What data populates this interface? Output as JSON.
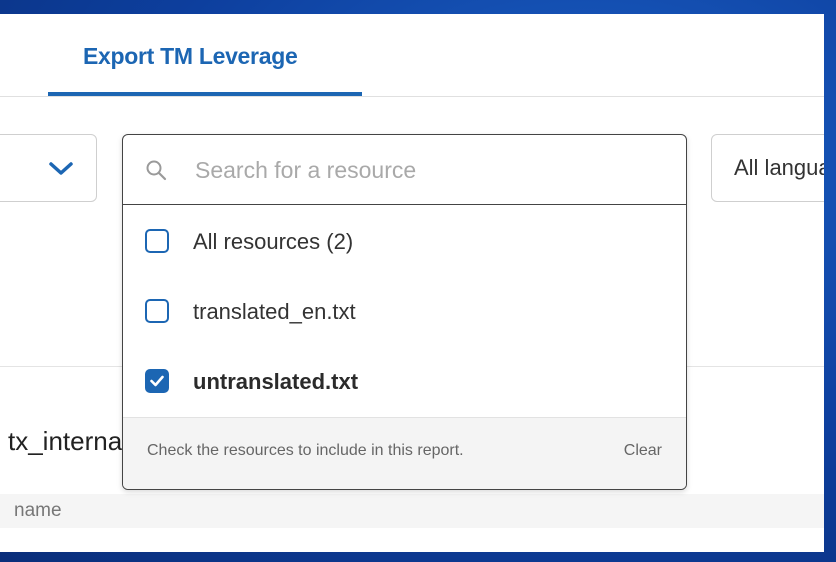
{
  "tabs": [
    {
      "label": "Export TM Leverage",
      "active": true
    }
  ],
  "left_dropdown": {
    "icon": "chevron-down-icon"
  },
  "resource_picker": {
    "search_placeholder": "Search for a resource",
    "search_value": "",
    "options": [
      {
        "label": "All resources (2)",
        "checked": false
      },
      {
        "label": "translated_en.txt",
        "checked": false
      },
      {
        "label": "untranslated.txt",
        "checked": true
      }
    ],
    "footer_hint": "Check the resources to include in this report.",
    "clear_label": "Clear"
  },
  "language_select": {
    "value": "All languages"
  },
  "section": {
    "title": "tx_internal"
  },
  "table": {
    "columns": [
      "name"
    ]
  },
  "colors": {
    "accent": "#1c66b3",
    "background": "#0d3f9e"
  }
}
